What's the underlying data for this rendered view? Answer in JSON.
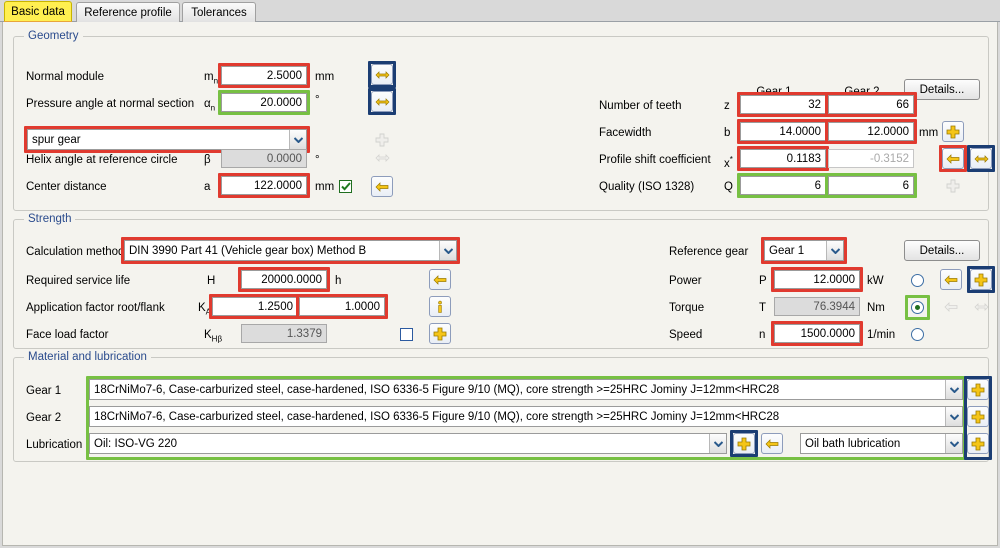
{
  "tabs": [
    {
      "label": "Basic data",
      "active": true
    },
    {
      "label": "Reference profile",
      "active": false
    },
    {
      "label": "Tolerances",
      "active": false
    }
  ],
  "geometry": {
    "legend": "Geometry",
    "normal_module": {
      "label": "Normal module",
      "symbol": "m",
      "sub": "n",
      "value": "2.5000",
      "unit": "mm"
    },
    "pressure_angle": {
      "label": "Pressure angle at normal section",
      "symbol": "α",
      "sub": "n",
      "value": "20.0000",
      "unit": "°"
    },
    "gear_type": {
      "value": "spur gear"
    },
    "helix_angle": {
      "label": "Helix angle at reference circle",
      "symbol": "β",
      "value": "0.0000",
      "unit": "°"
    },
    "center_distance": {
      "label": "Center distance",
      "symbol": "a",
      "value": "122.0000",
      "unit": "mm",
      "checked": true
    },
    "col_gear1": "Gear 1",
    "col_gear2": "Gear 2",
    "details_label": "Details...",
    "teeth": {
      "label": "Number of teeth",
      "symbol": "z",
      "gear1": "32",
      "gear2": "66",
      "unit": ""
    },
    "facewidth": {
      "label": "Facewidth",
      "symbol": "b",
      "gear1": "14.0000",
      "gear2": "12.0000",
      "unit": "mm"
    },
    "profile_shift": {
      "label": "Profile shift coefficient",
      "symbol": "x",
      "sup": "*",
      "gear1": "0.1183",
      "gear2": "-0.3152",
      "unit": ""
    },
    "quality": {
      "label": "Quality (ISO 1328)",
      "symbol": "Q",
      "gear1": "6",
      "gear2": "6",
      "unit": ""
    }
  },
  "strength": {
    "legend": "Strength",
    "calculation_method": {
      "label": "Calculation method",
      "value": "DIN 3990 Part 41 (Vehicle gear box) Method B"
    },
    "service_life": {
      "label": "Required service life",
      "symbol": "H",
      "value": "20000.0000",
      "unit": "h"
    },
    "application_factor": {
      "label": "Application factor root/flank",
      "symbol": "K",
      "sub": "A",
      "value_root": "1.2500",
      "value_flank": "1.0000"
    },
    "face_load_factor": {
      "label": "Face load factor",
      "symbol": "K",
      "sub": "Hβ",
      "value": "1.3379",
      "checked": false
    },
    "reference_gear": {
      "label": "Reference gear",
      "value": "Gear 1"
    },
    "details_label": "Details...",
    "power": {
      "label": "Power",
      "symbol": "P",
      "value": "12.0000",
      "unit": "kW",
      "selected": false
    },
    "torque": {
      "label": "Torque",
      "symbol": "T",
      "value": "76.3944",
      "unit": "Nm",
      "selected": true
    },
    "speed": {
      "label": "Speed",
      "symbol": "n",
      "value": "1500.0000",
      "unit": "1/min",
      "selected": false
    }
  },
  "material": {
    "legend": "Material and lubrication",
    "gear1": {
      "label": "Gear 1",
      "value": "18CrNiMo7-6, Case-carburized steel, case-hardened, ISO 6336-5 Figure 9/10 (MQ), core strength >=25HRC Jominy J=12mm<HRC28"
    },
    "gear2": {
      "label": "Gear 2",
      "value": "18CrNiMo7-6, Case-carburized steel, case-hardened, ISO 6336-5 Figure 9/10 (MQ), core strength >=25HRC Jominy J=12mm<HRC28"
    },
    "lubrication": {
      "label": "Lubrication",
      "value": "Oil: ISO-VG 220",
      "type_value": "Oil bath lubrication"
    }
  },
  "icons": {
    "double_arrow": "double-arrow-icon",
    "back_arrow": "back-arrow-icon",
    "plus": "plus-icon",
    "info": "info-icon",
    "chevron_down": "chevron-down-icon",
    "check": "check-icon"
  },
  "colors": {
    "highlight_red": "#e03a2f",
    "highlight_green": "#77c043",
    "highlight_navy": "#1b3d73",
    "tab_active": "#ffef50",
    "legend_text": "#2a4b8d"
  }
}
